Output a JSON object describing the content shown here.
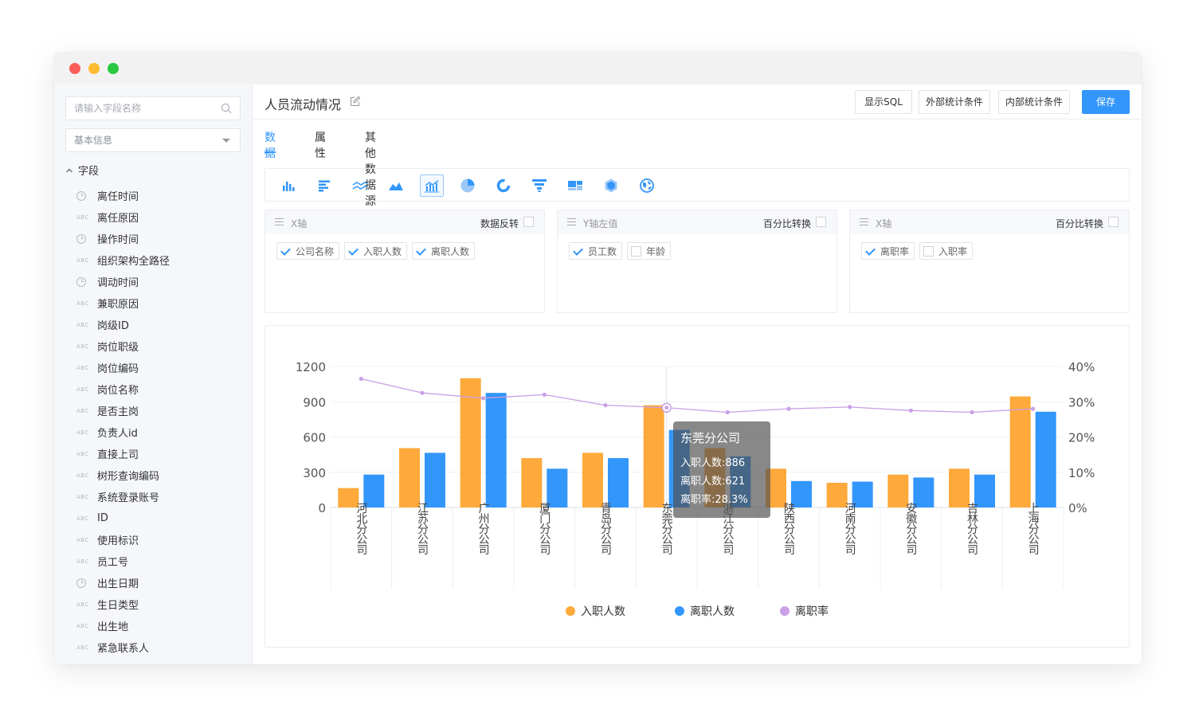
{
  "sidebar": {
    "search_placeholder": "请输入字段名称",
    "category_select": "基本信息",
    "tree_title": "字段",
    "fields": [
      {
        "type": "date",
        "label": "离任时间"
      },
      {
        "type": "text",
        "label": "离任原因"
      },
      {
        "type": "date",
        "label": "操作时间"
      },
      {
        "type": "text",
        "label": "组织架构全路径"
      },
      {
        "type": "date",
        "label": "调动时间"
      },
      {
        "type": "text",
        "label": "兼职原因"
      },
      {
        "type": "text",
        "label": "岗级ID"
      },
      {
        "type": "text",
        "label": "岗位职级"
      },
      {
        "type": "text",
        "label": "岗位编码"
      },
      {
        "type": "text",
        "label": "岗位名称"
      },
      {
        "type": "text",
        "label": "是否主岗"
      },
      {
        "type": "text",
        "label": "负责人id"
      },
      {
        "type": "text",
        "label": "直接上司"
      },
      {
        "type": "text",
        "label": "树形查询编码"
      },
      {
        "type": "text",
        "label": "系统登录账号"
      },
      {
        "type": "text",
        "label": "ID"
      },
      {
        "type": "text",
        "label": "使用标识"
      },
      {
        "type": "text",
        "label": "员工号"
      },
      {
        "type": "date",
        "label": "出生日期"
      },
      {
        "type": "text",
        "label": "生日类型"
      },
      {
        "type": "text",
        "label": "出生地"
      },
      {
        "type": "text",
        "label": "紧急联系人"
      }
    ],
    "text_icon_label": "ABC"
  },
  "header": {
    "title": "人员流动情况",
    "buttons": {
      "show_sql": "显示SQL",
      "outer_conditions": "外部统计条件",
      "inner_conditions": "内部统计条件",
      "save": "保存"
    }
  },
  "tabs": [
    "数据",
    "属性",
    "其他数据源"
  ],
  "chart_types": [
    "bar-chart-icon",
    "horizontal-bar-icon",
    "line-chart-icon",
    "area-chart-icon",
    "combo-chart-icon",
    "pie-chart-icon",
    "donut-chart-icon",
    "funnel-chart-icon",
    "treemap-icon",
    "radar-icon",
    "map-globe-icon"
  ],
  "panels": [
    {
      "title": "X轴",
      "option": "数据反转",
      "tags": [
        {
          "label": "公司名称",
          "checked": true
        },
        {
          "label": "入职人数",
          "checked": true
        },
        {
          "label": "离职人数",
          "checked": true
        }
      ]
    },
    {
      "title": "Y轴左值",
      "option": "百分比转换",
      "tags": [
        {
          "label": "员工数",
          "checked": true
        },
        {
          "label": "年龄",
          "checked": false
        }
      ]
    },
    {
      "title": "X轴",
      "option": "百分比转换",
      "tags": [
        {
          "label": "离职率",
          "checked": true
        },
        {
          "label": "入职率",
          "checked": false
        }
      ]
    }
  ],
  "colors": {
    "accent": "#3296fa",
    "hire": "#fea93b",
    "leave": "#3296fa",
    "rate": "#c9a0e6"
  },
  "chart_data": {
    "type": "bar",
    "categories": [
      "河北分公司",
      "江苏分公司",
      "广州分公司",
      "厦门分公司",
      "青岛分公司",
      "东莞分公司",
      "浙江分公司",
      "陕西分公司",
      "河南分公司",
      "安徽分公司",
      "吉林分公司",
      "上海分公司"
    ],
    "series": [
      {
        "name": "入职人数",
        "values": [
          165,
          505,
          1100,
          420,
          465,
          870,
          505,
          330,
          210,
          280,
          330,
          945
        ],
        "axis": "left",
        "kind": "bar"
      },
      {
        "name": "离职人数",
        "values": [
          280,
          465,
          975,
          330,
          420,
          660,
          435,
          225,
          220,
          255,
          280,
          815
        ],
        "axis": "left",
        "kind": "bar"
      },
      {
        "name": "离职率",
        "values": [
          36.5,
          32.5,
          31,
          32,
          29,
          28.3,
          27,
          28,
          28.5,
          27.5,
          27,
          28
        ],
        "axis": "right",
        "kind": "line",
        "unit": "%"
      }
    ],
    "y_left": {
      "ticks": [
        0,
        300,
        600,
        900,
        1200
      ],
      "range": [
        0,
        1200
      ]
    },
    "y_right": {
      "ticks": [
        "0%",
        "10%",
        "20%",
        "30%",
        "40%"
      ],
      "range": [
        0,
        40
      ]
    },
    "legend": [
      "入职人数",
      "离职人数",
      "离职率"
    ],
    "legend_position": "bottom",
    "tooltip": {
      "category_index": 5,
      "title": "东莞分公司",
      "lines": [
        "入职人数:886",
        "离职人数:621",
        "离职率:28.3%"
      ]
    }
  }
}
